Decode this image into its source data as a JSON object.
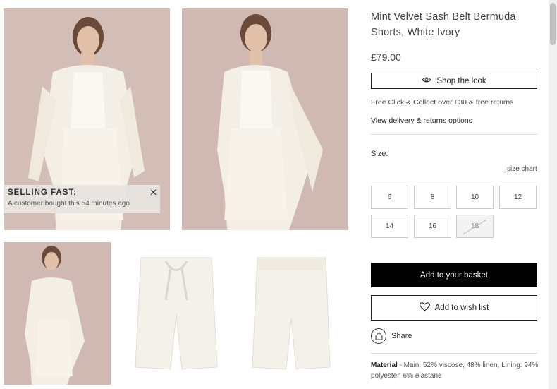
{
  "product": {
    "title": "Mint Velvet Sash Belt Bermuda Shorts, White Ivory",
    "price": "£79.00",
    "shop_the_look_label": "Shop the look",
    "delivery_text": "Free Click & Collect over £30 & free returns",
    "delivery_link": "View delivery & returns options",
    "size_label": "Size:",
    "size_chart_label": "size chart",
    "sizes": [
      {
        "label": "6",
        "available": true
      },
      {
        "label": "8",
        "available": true
      },
      {
        "label": "10",
        "available": true
      },
      {
        "label": "12",
        "available": true
      },
      {
        "label": "14",
        "available": true
      },
      {
        "label": "16",
        "available": true
      },
      {
        "label": "18",
        "available": false
      }
    ],
    "add_to_basket_label": "Add to your basket",
    "wishlist_label": "Add to wish list",
    "share_label": "Share",
    "material_label": "Material",
    "material_text": " - Main: 52% viscose, 48% linen, Lining: 94% polyester, 6% elastane"
  },
  "selling_fast": {
    "title": "SELLING FAST:",
    "text": "A customer bought this 54 minutes ago",
    "close": "✕"
  },
  "colors": {
    "background_photo": "#cfb9b2",
    "garment": "#f3efe6",
    "button_primary": "#000000"
  }
}
